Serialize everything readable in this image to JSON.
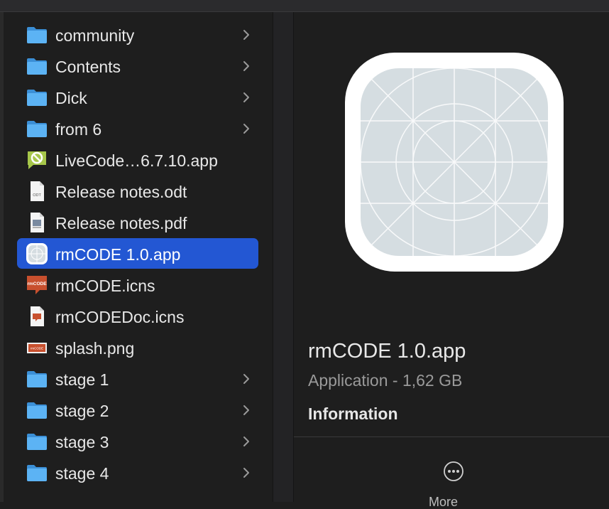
{
  "files": [
    {
      "label": "community",
      "kind": "folder",
      "expandable": true
    },
    {
      "label": "Contents",
      "kind": "folder",
      "expandable": true
    },
    {
      "label": "Dick",
      "kind": "folder",
      "expandable": true
    },
    {
      "label": "from 6",
      "kind": "folder",
      "expandable": true
    },
    {
      "label": "LiveCode…6.7.10.app",
      "kind": "livecode-app",
      "expandable": false
    },
    {
      "label": "Release notes.odt",
      "kind": "odt-document",
      "expandable": false,
      "badge": "ODT"
    },
    {
      "label": "Release notes.pdf",
      "kind": "pdf-document",
      "expandable": false
    },
    {
      "label": "rmCODE 1.0.app",
      "kind": "generic-app",
      "expandable": false,
      "selected": true
    },
    {
      "label": "rmCODE.icns",
      "kind": "icns-file",
      "expandable": false,
      "badge": "rmCODE"
    },
    {
      "label": "rmCODEDoc.icns",
      "kind": "icns-doc-file",
      "expandable": false,
      "badge": "rmCODE"
    },
    {
      "label": "splash.png",
      "kind": "image-file",
      "expandable": false,
      "badge": "rmCODE"
    },
    {
      "label": "stage 1",
      "kind": "folder",
      "expandable": true
    },
    {
      "label": "stage 2",
      "kind": "folder",
      "expandable": true
    },
    {
      "label": "stage 3",
      "kind": "folder",
      "expandable": true
    },
    {
      "label": "stage 4",
      "kind": "folder",
      "expandable": true
    }
  ],
  "preview": {
    "name": "rmCODE 1.0.app",
    "kind": "Application - 1,62 GB",
    "info_heading": "Information",
    "more_label": "More"
  },
  "colors": {
    "selection": "#2357d3",
    "folder": "#4ca6f0",
    "background": "#1e1e1e"
  }
}
